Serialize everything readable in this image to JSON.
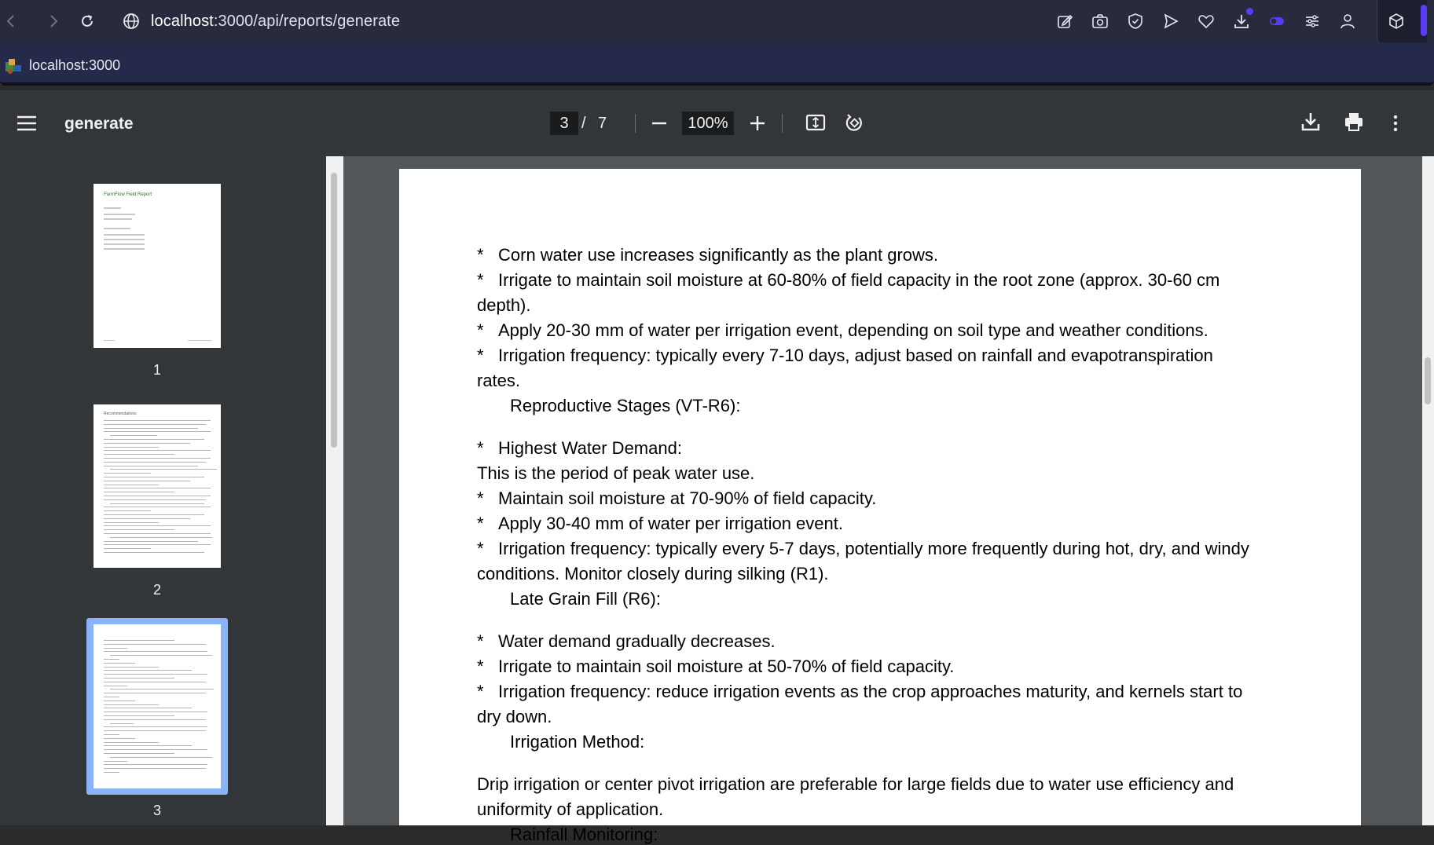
{
  "browser": {
    "url_host": "localhost",
    "url_rest": ":3000/api/reports/generate",
    "tab_title": "localhost:3000",
    "accent": "#5b3cf5"
  },
  "viewer": {
    "doc_title": "generate",
    "current_page": "3",
    "separator": "/",
    "total_pages": "7",
    "zoom": "100%"
  },
  "thumbnails": [
    {
      "label": "1",
      "heading": "FarmFlow Field Report"
    },
    {
      "label": "2",
      "heading": "Recommendations"
    },
    {
      "label": "3",
      "selected": true
    }
  ],
  "page_content": {
    "bullet": "*",
    "lines": [
      {
        "kind": "bullet",
        "text": "Corn water use increases significantly as the plant grows."
      },
      {
        "kind": "bullet",
        "text": "Irrigate to maintain soil moisture at 60-80% of field capacity in the root zone (approx. 30-60 cm"
      },
      {
        "kind": "plain",
        "text": "depth)."
      },
      {
        "kind": "bullet",
        "text": "Apply 20-30 mm of water per irrigation event, depending on soil type and weather conditions."
      },
      {
        "kind": "bullet",
        "text": "Irrigation frequency: typically every 7-10 days, adjust based on rainfall and evapotranspiration"
      },
      {
        "kind": "plain",
        "text": "rates."
      },
      {
        "kind": "indent",
        "text": "Reproductive Stages (VT-R6):"
      },
      {
        "kind": "bullet",
        "text": "Highest Water Demand:"
      },
      {
        "kind": "plain",
        "text": "This is the period of peak water use."
      },
      {
        "kind": "bullet",
        "text": "Maintain soil moisture at 70-90% of field capacity."
      },
      {
        "kind": "bullet",
        "text": "Apply 30-40 mm of water per irrigation event."
      },
      {
        "kind": "bullet",
        "text": "Irrigation frequency: typically every 5-7 days, potentially more frequently during hot, dry, and windy"
      },
      {
        "kind": "plain",
        "text": "conditions. Monitor closely during silking (R1)."
      },
      {
        "kind": "indent",
        "text": "Late Grain Fill (R6):"
      },
      {
        "kind": "bullet",
        "text": "Water demand gradually decreases."
      },
      {
        "kind": "bullet",
        "text": "Irrigate to maintain soil moisture at 50-70% of field capacity."
      },
      {
        "kind": "bullet",
        "text": "Irrigation frequency: reduce irrigation events as the crop approaches maturity, and kernels start to"
      },
      {
        "kind": "plain",
        "text": "dry down."
      },
      {
        "kind": "indent",
        "text": "Irrigation Method:"
      },
      {
        "kind": "plain",
        "text": "Drip irrigation or center pivot irrigation are preferable for large fields due to water use efficiency and"
      },
      {
        "kind": "plain",
        "text": "uniformity of application."
      },
      {
        "kind": "indent",
        "text": "Rainfall Monitoring:"
      }
    ]
  }
}
